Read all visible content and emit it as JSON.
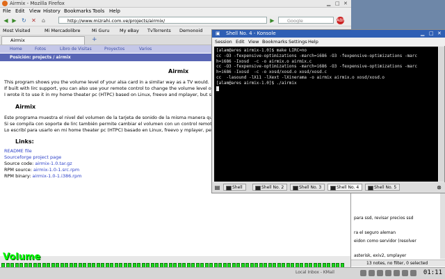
{
  "firefox": {
    "title": "Airmix - Mozilla Firefox",
    "menu": [
      "File",
      "Edit",
      "View",
      "History",
      "Bookmarks",
      "Tools",
      "Help"
    ],
    "url": "http://www.mizrahi.com.ve/projects/airmix/",
    "search_placeholder": "Google",
    "bookmarks": [
      "Most Visited",
      "Mi Mercadolibre",
      "Mi Guru",
      "My eBay",
      "TvTorrents",
      "Demonoid"
    ],
    "tab_title": "Airmix",
    "tab_new": "+"
  },
  "page": {
    "nav": [
      "Home",
      "Fotos",
      "Libro de Visitas",
      "Proyectos",
      "Varios"
    ],
    "position": "Posición: projects / airmix",
    "heading_en": "Airmix",
    "paragraph_en": [
      "This program shows you the volume level of your alsa card in a similar way as a TV would.",
      "If built with lirc support, you can also use your remote control to change the volume level or m",
      "I wrote it to use it in my home theater pc (HTPC) based on Linux, freevo and mplayer, but sinc"
    ],
    "heading_es": "Airmix",
    "paragraph_es": [
      "Este programa muestra el nivel del volumen de la tarjeta de sonido de la misma manera que l",
      "Si se compila con soporte de lirc también permite cambiar el volumen con un control remoto.",
      "Lo escribí para usarlo en mi home theater pc (HTPC) basado en Linux, freevo y mplayer, pero"
    ],
    "links_heading": "Links:",
    "links": [
      {
        "label": "",
        "text": "README file"
      },
      {
        "label": "",
        "text": "Sourceforge project page"
      },
      {
        "label": "Source code: ",
        "text": "airmix-1.0.tar.gz"
      },
      {
        "label": "RPM source: ",
        "text": "airmix-1.0-1.src.rpm"
      },
      {
        "label": "RPM binary: ",
        "text": "airmix-1.0-1.i386.rpm"
      }
    ]
  },
  "konsole": {
    "title": "Shell No. 4 - Konsole",
    "menu": [
      "Session",
      "Edit",
      "View",
      "Bookmarks",
      "Settings",
      "Help"
    ],
    "lines": [
      "[alam@ares airmix-1.0]$ make LIRC=no",
      "cc -O3 -fexpensive-optimizations -march=i686 -O3 -fexpensive-optimizations -marc",
      "h=i686 -Ixosd  -c -o airmix.o airmix.c",
      "cc -O3 -fexpensive-optimizations -march=i686 -O3 -fexpensive-optimizations -marc",
      "h=i686 -Ixosd  -c -o xosd/xosd.o xosd/xosd.c",
      "cc  -lasound -lX11 -lXext -lXinerama -o airmix airmix.o xosd/xosd.o",
      "[alam@ares airmix-1.0]$ ./airmix"
    ],
    "tabs": [
      "Shell",
      "Shell No. 2",
      "Shell No. 3",
      "Shell No. 4",
      "Shell No. 5"
    ],
    "active_tab": 3
  },
  "notes": {
    "rows": [
      "para ssd, revisar precios ssd",
      "ra el seguro aleman",
      "eidon como servidor (resolver",
      "asterisk, exiv2, smplayer"
    ],
    "status": "13 notes, no filter, 0 selected"
  },
  "osd": {
    "label": "Volume",
    "level": 1.0
  },
  "taskbar": {
    "items": [
      "Local Inbox - KMail"
    ],
    "clock": "01:11"
  }
}
